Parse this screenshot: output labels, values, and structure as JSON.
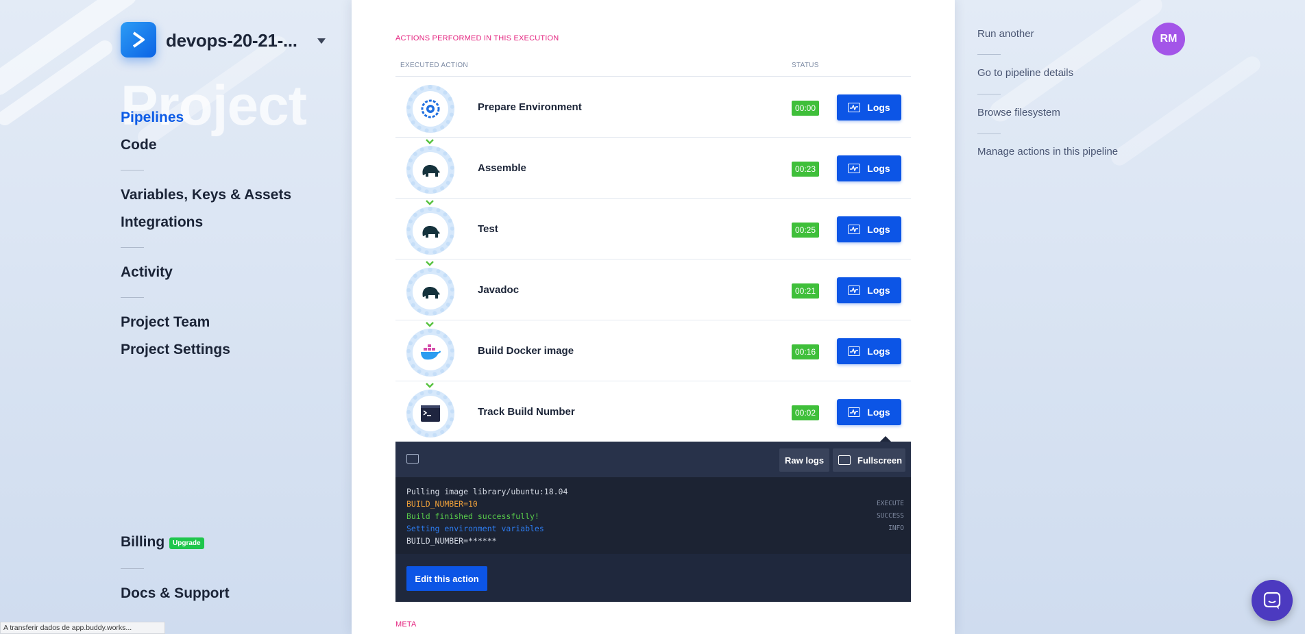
{
  "sidebar": {
    "project_name": "devops-20-21-...",
    "watermark": "Project",
    "nav": {
      "pipelines": "Pipelines",
      "code": "Code",
      "variables": "Variables, Keys & Assets",
      "integrations": "Integrations",
      "activity": "Activity",
      "team": "Project Team",
      "settings": "Project Settings",
      "billing": "Billing",
      "billing_badge": "Upgrade",
      "docs": "Docs & Support"
    }
  },
  "main": {
    "section_title": "ACTIONS PERFORMED IN THIS EXECUTION",
    "col_action": "EXECUTED ACTION",
    "col_status": "STATUS",
    "logs_label": "Logs",
    "actions": [
      {
        "name": "Prepare Environment",
        "status": "00:00",
        "icon": "gear-refresh-icon"
      },
      {
        "name": "Assemble",
        "status": "00:23",
        "icon": "gradle-elephant-icon"
      },
      {
        "name": "Test",
        "status": "00:25",
        "icon": "gradle-elephant-icon"
      },
      {
        "name": "Javadoc",
        "status": "00:21",
        "icon": "gradle-elephant-icon"
      },
      {
        "name": "Build Docker image",
        "status": "00:16",
        "icon": "docker-whale-icon"
      },
      {
        "name": "Track Build Number",
        "status": "00:02",
        "icon": "terminal-icon"
      }
    ],
    "log_panel": {
      "raw_logs": "Raw logs",
      "fullscreen": "Fullscreen",
      "lines": [
        {
          "text": "Pulling image library/ubuntu:18.04",
          "color": "#d6dbe5"
        },
        {
          "text": "BUILD_NUMBER=10",
          "color": "#f0a13a"
        },
        {
          "text": "Build finished successfully!",
          "color": "#57c94a"
        },
        {
          "text": "Setting environment variables",
          "color": "#2d7cf0"
        },
        {
          "text": "BUILD_NUMBER=******",
          "color": "#d6dbe5"
        }
      ],
      "tags": [
        "EXECUTE",
        "SUCCESS",
        "INFO"
      ],
      "edit_action": "Edit this action"
    },
    "meta_title": "META"
  },
  "right": {
    "links": {
      "run_another": "Run another",
      "pipeline_details": "Go to pipeline details",
      "browse_fs": "Browse filesystem",
      "manage_actions": "Manage actions in this pipeline"
    },
    "avatar_initials": "RM"
  },
  "statusbar": "A transferir dados de app.buddy.works...",
  "colors": {
    "accent": "#0c55e6",
    "status_green": "#3fbf3a",
    "section_pink": "#e4237f",
    "avatar": "#a355e8"
  }
}
